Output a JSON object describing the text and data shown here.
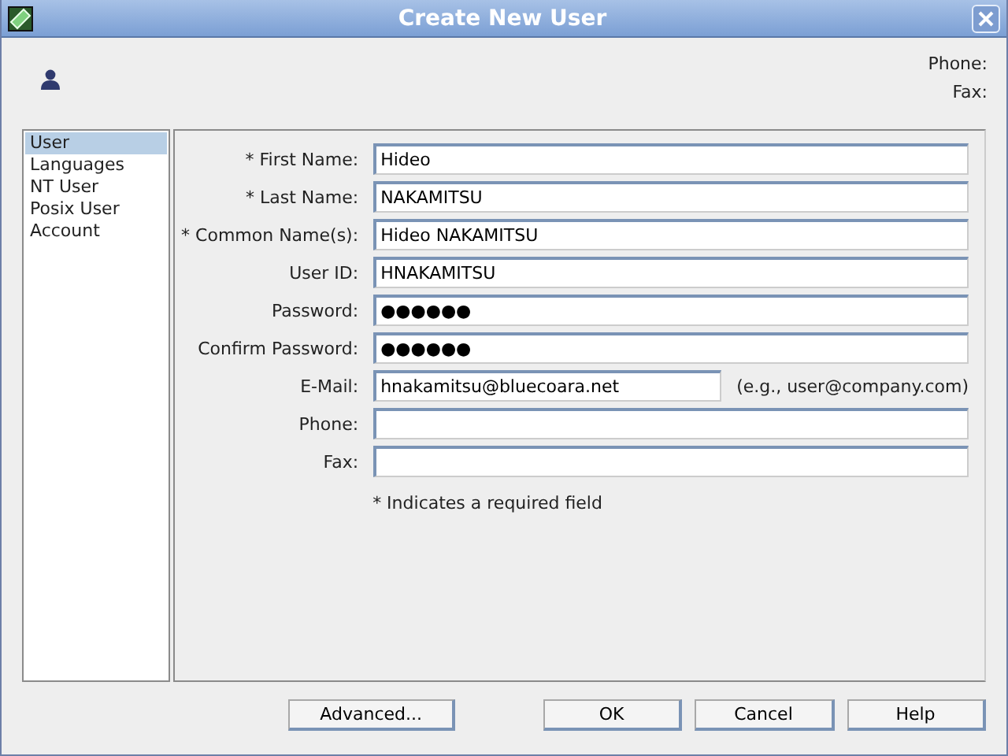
{
  "window": {
    "title": "Create New User"
  },
  "header": {
    "labels": [
      "Phone:",
      "Fax:"
    ]
  },
  "sidebar": {
    "items": [
      {
        "label": "User",
        "selected": true
      },
      {
        "label": "Languages",
        "selected": false
      },
      {
        "label": "NT User",
        "selected": false
      },
      {
        "label": "Posix User",
        "selected": false
      },
      {
        "label": "Account",
        "selected": false
      }
    ]
  },
  "form": {
    "fields": [
      {
        "label": "* First Name:",
        "value": "Hideo"
      },
      {
        "label": "* Last Name:",
        "value": "NAKAMITSU"
      },
      {
        "label": "* Common Name(s):",
        "value": "Hideo NAKAMITSU"
      },
      {
        "label": "User ID:",
        "value": "HNAKAMITSU"
      },
      {
        "label": "Password:",
        "value": "●●●●●●"
      },
      {
        "label": "Confirm Password:",
        "value": "●●●●●●"
      },
      {
        "label": "E-Mail:",
        "value": "hnakamitsu@bluecoara.net",
        "hint": "(e.g., user@company.com)"
      },
      {
        "label": "Phone:"
      },
      {
        "label": "Fax:"
      }
    ],
    "note": "* Indicates a required field"
  },
  "buttons": {
    "left": [
      "Advanced..."
    ],
    "right": [
      "OK",
      "Cancel",
      "Help"
    ]
  }
}
